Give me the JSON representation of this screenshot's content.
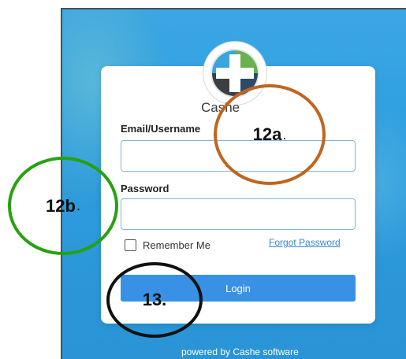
{
  "login_card": {
    "app_name": "Cashe",
    "email_label": "Email/Username",
    "email_value": "",
    "password_label": "Password",
    "password_value": "",
    "remember_label": "Remember Me",
    "remember_checked": false,
    "forgot_link": "Forgot Password",
    "login_button": "Login"
  },
  "footer": {
    "powered_by": "powered by Cashe software"
  },
  "annotations": [
    {
      "label": "12a",
      "suffix": ".",
      "color": "#c0651f"
    },
    {
      "label": "12b",
      "suffix": ".",
      "color": "#27a10f"
    },
    {
      "label": "13.",
      "suffix": "",
      "color": "#111111"
    }
  ],
  "icons": {
    "logo": "cashe-logo-icon",
    "checkbox": "checkbox-icon"
  },
  "colors": {
    "background": "#2f9fe0",
    "accent": "#3891e4",
    "link": "#3a86d4"
  }
}
